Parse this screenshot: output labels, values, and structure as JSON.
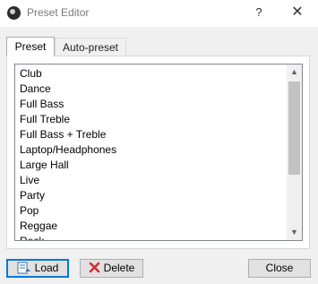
{
  "window": {
    "title": "Preset Editor",
    "help_label": "?",
    "close_glyph": "✕"
  },
  "tabs": [
    {
      "label": "Preset",
      "selected": true
    },
    {
      "label": "Auto-preset",
      "selected": false
    }
  ],
  "preset_list": {
    "items": [
      "Club",
      "Dance",
      "Full Bass",
      "Full Treble",
      "Full Bass + Treble",
      "Laptop/Headphones",
      "Large Hall",
      "Live",
      "Party",
      "Pop",
      "Reggae",
      "Rock"
    ]
  },
  "buttons": {
    "load_label": "Load",
    "delete_label": "Delete",
    "close_label": "Close"
  },
  "icons": {
    "app": "app-disc-icon",
    "load": "load-file-icon",
    "delete": "delete-x-icon",
    "delete_color": "#d03030",
    "load_color": "#3a6fb0"
  }
}
